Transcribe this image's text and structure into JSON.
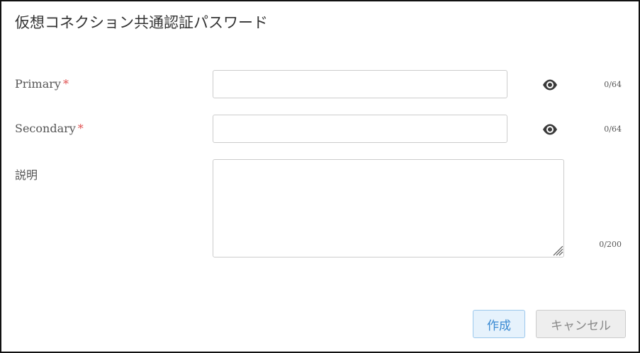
{
  "dialog": {
    "title": "仮想コネクション共通認証パスワード"
  },
  "fields": {
    "primary": {
      "label": "Primary",
      "required_mark": "*",
      "value": "",
      "placeholder": "",
      "counter": "0/64",
      "toggle_icon": "eye-icon"
    },
    "secondary": {
      "label": "Secondary",
      "required_mark": "*",
      "value": "",
      "placeholder": "",
      "counter": "0/64",
      "toggle_icon": "eye-icon"
    },
    "description": {
      "label": "説明",
      "value": "",
      "placeholder": "",
      "counter": "0/200"
    }
  },
  "actions": {
    "create_label": "作成",
    "cancel_label": "キャンセル"
  },
  "colors": {
    "required": "#e05050",
    "primary_button_text": "#3a8ad3",
    "primary_button_bg": "#e6f2fc",
    "cancel_button_text": "#888888"
  }
}
